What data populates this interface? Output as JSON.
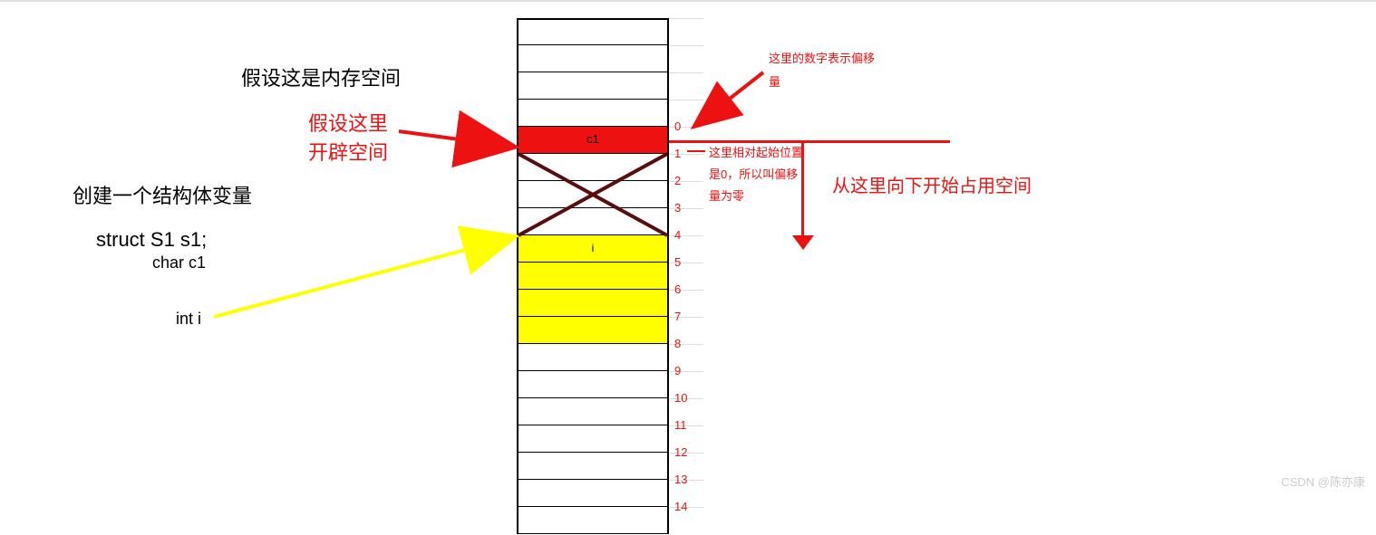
{
  "labels": {
    "title": "假设这是内存空间",
    "assumeHere1": "假设这里",
    "assumeHere2": "开辟空间",
    "createStruct": "创建一个结构体变量",
    "structDecl": "struct S1 s1;",
    "charC1": "char c1",
    "intI": "int i",
    "offsetMeaning1": "这里的数字表示偏移",
    "offsetMeaning2": "量",
    "relStart1": "这里相对起始位置",
    "relStart2": "是0，所以叫偏移",
    "relStart3": "量为零",
    "fromHereDown": "从这里向下开始占用空间",
    "watermark": "CSDN @陈亦康"
  },
  "memory": {
    "cells": [
      {
        "label": "",
        "fill": "none"
      },
      {
        "label": "",
        "fill": "none"
      },
      {
        "label": "",
        "fill": "none"
      },
      {
        "label": "",
        "fill": "none"
      },
      {
        "label": "c1",
        "fill": "red",
        "offset": 0
      },
      {
        "label": "",
        "fill": "cross",
        "offset": 1
      },
      {
        "label": "",
        "fill": "cross",
        "offset": 2
      },
      {
        "label": "",
        "fill": "cross",
        "offset": 3
      },
      {
        "label": "i",
        "fill": "yellow",
        "offset": 4
      },
      {
        "label": "",
        "fill": "yellow",
        "offset": 5
      },
      {
        "label": "",
        "fill": "yellow",
        "offset": 6
      },
      {
        "label": "",
        "fill": "yellow",
        "offset": 7
      },
      {
        "label": "",
        "fill": "none",
        "offset": 8
      },
      {
        "label": "",
        "fill": "none",
        "offset": 9
      },
      {
        "label": "",
        "fill": "none",
        "offset": 10
      },
      {
        "label": "",
        "fill": "none",
        "offset": 11
      },
      {
        "label": "",
        "fill": "none",
        "offset": 12
      },
      {
        "label": "",
        "fill": "none",
        "offset": 13
      },
      {
        "label": "",
        "fill": "none",
        "offset": 14
      }
    ]
  },
  "offsets": [
    "0",
    "1",
    "2",
    "3",
    "4",
    "5",
    "6",
    "7",
    "8",
    "9",
    "10",
    "11",
    "12",
    "13",
    "14"
  ]
}
